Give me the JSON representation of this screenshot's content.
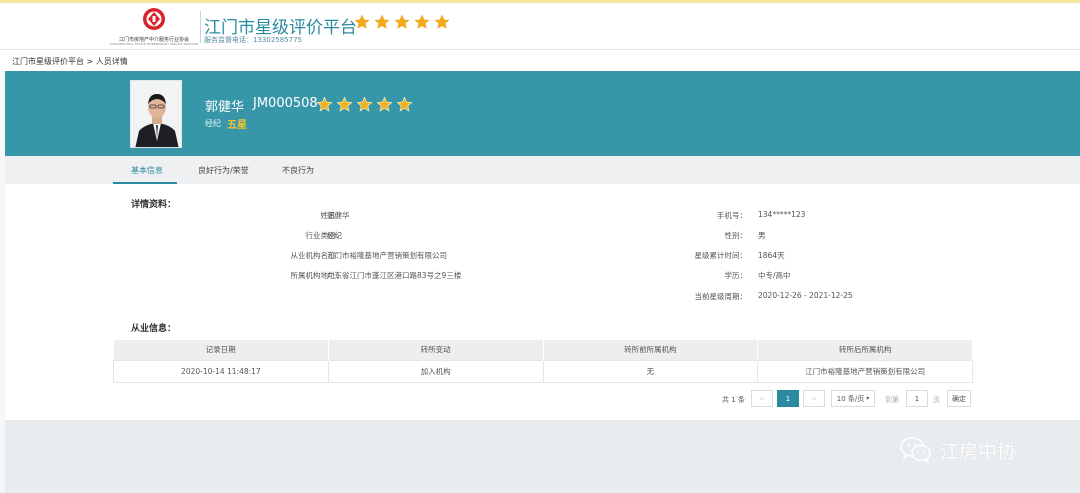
{
  "header": {
    "logo_text": "江门市房地产中介服务行业协会",
    "logo_sub": "JIANGMEN REAL ESTATE INTERMEDIARY SERVICE INDUSTRY ASSOCIATION",
    "site_title": "江门市星级评价平台",
    "hotline": "服务监督电话：13302585775",
    "star_rating": 5,
    "colors": {
      "accent": "#2a8ba0",
      "star": "#f0a81c"
    }
  },
  "breadcrumb": "江门市星级评价平台 > 人员详情",
  "profile": {
    "name": "郭健华",
    "code": "JM000508",
    "type": "经纪",
    "level": "五星",
    "stars": 5,
    "banner_color": "#3797a8"
  },
  "tabs": [
    {
      "label": "基本信息",
      "active": true
    },
    {
      "label": "良好行为/荣誉",
      "active": false
    },
    {
      "label": "不良行为",
      "active": false
    }
  ],
  "details": {
    "title": "详情资料：",
    "left": [
      {
        "label": "姓名：",
        "value": "郭健华"
      },
      {
        "label": "行业类别：",
        "value": "经纪"
      },
      {
        "label": "从业机构名称：",
        "value": "江门市裕隆基地产营销策划有限公司"
      },
      {
        "label": "所属机构地址：",
        "value": "广东省江门市蓬江区港口路83号之9三楼"
      }
    ],
    "right": [
      {
        "label": "手机号：",
        "value": "134*****123"
      },
      {
        "label": "性别：",
        "value": "男"
      },
      {
        "label": "星级累计时间：",
        "value": "1864天"
      },
      {
        "label": "学历：",
        "value": "中专/高中"
      },
      {
        "label": "当前星级周期：",
        "value": "2020-12-26 - 2021-12-25"
      }
    ]
  },
  "employment": {
    "title": "从业信息：",
    "columns": [
      "记录日期",
      "转所变动",
      "转所前所属机构",
      "转所后所属机构"
    ],
    "rows": [
      [
        "2020-10-14 11:48:17",
        "加入机构",
        "无",
        "江门市裕隆基地产营销策划有限公司"
      ]
    ]
  },
  "pagination": {
    "total": "共 1 条",
    "prev": "<",
    "current_page": "1",
    "next": ">",
    "page_size": "10 条/页",
    "goto_label": "到第",
    "goto_value": "1",
    "page_unit": "页",
    "confirm": "确定"
  },
  "watermark": "江房中协"
}
